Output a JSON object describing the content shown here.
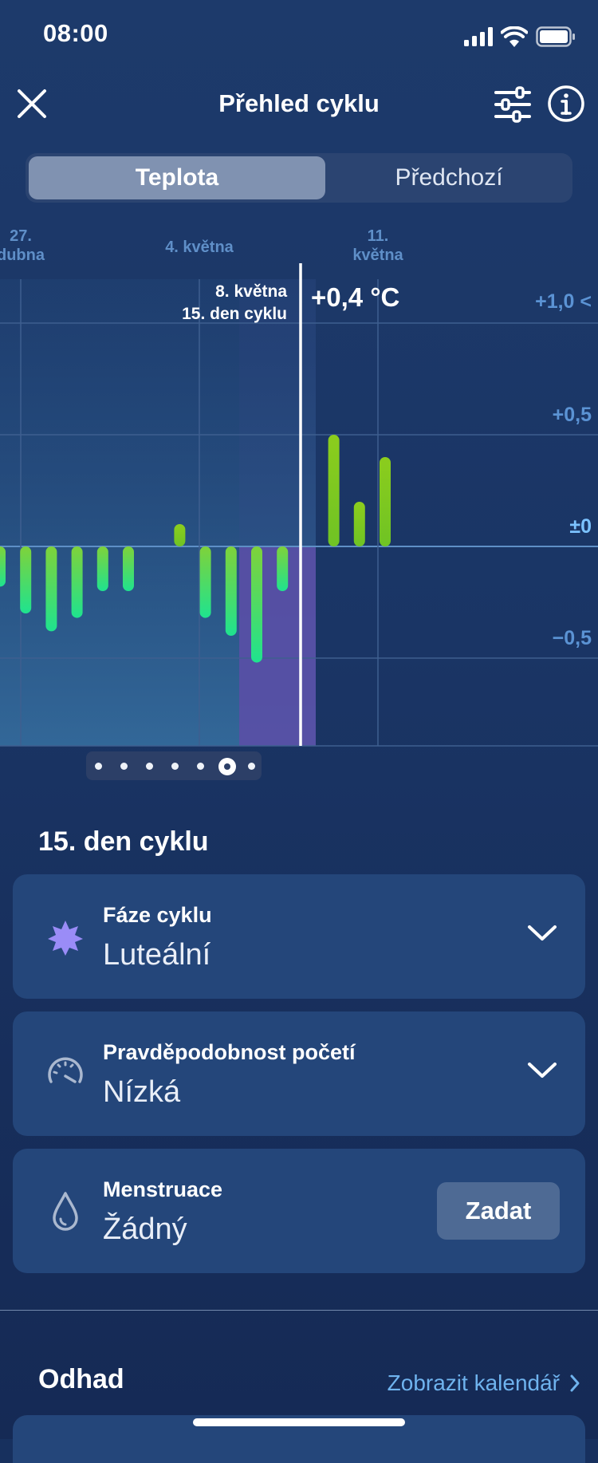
{
  "status_bar": {
    "time": "08:00"
  },
  "header": {
    "title": "Přehled cyklu"
  },
  "tabs": [
    {
      "label": "Teplota",
      "active": true
    },
    {
      "label": "Předchozí",
      "active": false
    }
  ],
  "chart": {
    "date_labels": [
      "27.\ndubna",
      "4. května",
      "11.\nkvětna"
    ],
    "y_labels": [
      "+1,0 <",
      "+0,5",
      "±0",
      "−0,5"
    ],
    "selected_date": "8. května",
    "selected_cycle_day": "15. den cyklu",
    "selected_value": "+0,4 °C",
    "pager_pages": 7,
    "pager_selected": 5
  },
  "chart_data": {
    "type": "bar",
    "ylim": [
      -0.9,
      1.0
    ],
    "series": [
      {
        "values": [
          -0.18,
          -0.3,
          -0.38,
          -0.32,
          -0.2,
          -0.2,
          0.0,
          0.1,
          -0.32,
          -0.4,
          -0.52,
          -0.2,
          0.0,
          0.5,
          0.2,
          0.4
        ]
      }
    ],
    "colors": {
      "bar_low": "#23e38d",
      "bar_high": "#8fc91c",
      "highlight": "#5a4fa6"
    }
  },
  "day_section": {
    "title": "15. den cyklu",
    "cards": [
      {
        "label": "Fáze cyklu",
        "value": "Luteální",
        "icon": "sparkle-icon"
      },
      {
        "label": "Pravděpodobnost početí",
        "value": "Nízká",
        "icon": "gauge-icon"
      },
      {
        "label": "Menstruace",
        "value": "Žádný",
        "icon": "drop-icon",
        "button": "Zadat"
      }
    ]
  },
  "estimate": {
    "title": "Odhad",
    "link": "Zobrazit kalendář"
  }
}
